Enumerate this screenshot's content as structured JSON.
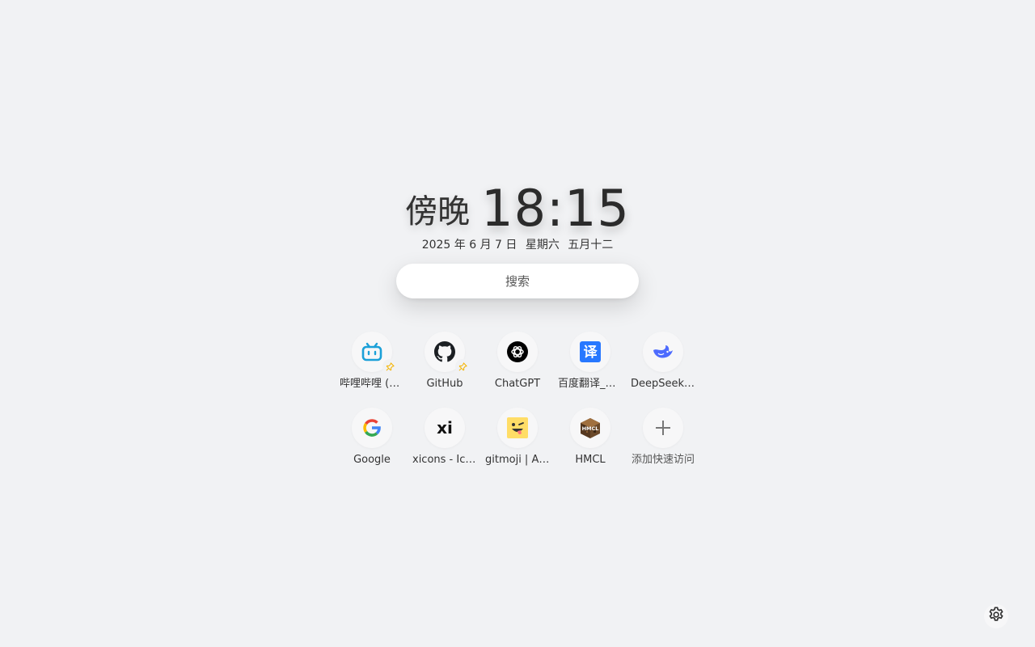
{
  "clock": {
    "period": "傍晚",
    "time": "18:15",
    "date": "2025 年 6 月 7 日",
    "weekday": "星期六",
    "lunar": "五月十二"
  },
  "search": {
    "placeholder": "搜索"
  },
  "shortcuts": [
    {
      "label": "哔哩哔哩 (゜-゜)つロ 干杯~-bilibili",
      "icon": "bilibili-icon",
      "pinned": true
    },
    {
      "label": "GitHub",
      "icon": "github-icon",
      "pinned": true
    },
    {
      "label": "ChatGPT",
      "icon": "chatgpt-icon",
      "pinned": false
    },
    {
      "label": "百度翻译_在线翻译",
      "icon": "baidu-translate-icon",
      "pinned": false
    },
    {
      "label": "DeepSeek | 深度求索",
      "icon": "deepseek-icon",
      "pinned": false
    },
    {
      "label": "Google",
      "icon": "google-icon",
      "pinned": false
    },
    {
      "label": "xicons - Icons",
      "icon": "xicons-icon",
      "pinned": false
    },
    {
      "label": "gitmoji | An emoji guide",
      "icon": "gitmoji-icon",
      "pinned": false
    },
    {
      "label": "HMCL",
      "icon": "hmcl-icon",
      "pinned": false
    }
  ],
  "add_shortcut": {
    "label": "添加快速访问",
    "icon": "plus-icon"
  },
  "colors": {
    "background": "#f1f2f4",
    "bilibili": "#1ba0d8",
    "pin": "#f5b400",
    "deepseek": "#4d6bfe",
    "baidu": "#2878ff"
  }
}
